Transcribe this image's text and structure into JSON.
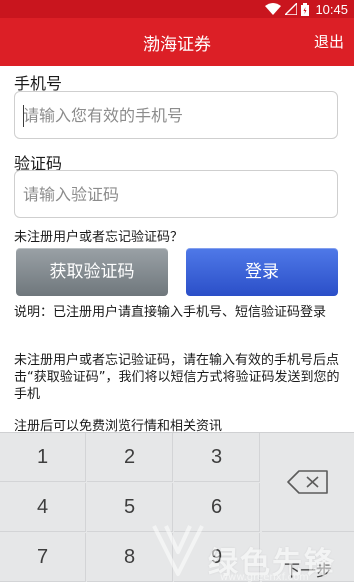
{
  "status_bar": {
    "time": "10:45",
    "icons": [
      "wifi-icon",
      "signal-icon",
      "battery-icon"
    ]
  },
  "app_bar": {
    "title": "渤海证券",
    "logout_label": "退出",
    "color": "#dc1f26"
  },
  "phone": {
    "label": "手机号",
    "placeholder": "请输入您有效的手机号",
    "value": ""
  },
  "code": {
    "label": "验证码",
    "placeholder": "请输入验证码",
    "value": ""
  },
  "hint": "未注册用户或者忘记验证码？",
  "buttons": {
    "get_code": {
      "label": "获取验证码",
      "color": "#7f878c"
    },
    "login": {
      "label": "登录",
      "color": "#3a5fd8"
    }
  },
  "notes": {
    "note1": "说明：已注册用户请直接输入手机号、短信验证码登录",
    "note2": "未注册用户或者忘记验证码，请在输入有效的手机号后点击“获取验证码”，我们将以短信方式将验证码发送到您的手机",
    "note3": "注册后可以免费浏览行情和相关资讯"
  },
  "keyboard": {
    "keys": [
      "1",
      "2",
      "3",
      "4",
      "5",
      "6",
      "7",
      "8",
      "9"
    ],
    "backspace_icon": "backspace-icon",
    "next_label": "下一步"
  },
  "watermark": {
    "text": "绿色先锋",
    "url": "www.greenxf.com"
  }
}
